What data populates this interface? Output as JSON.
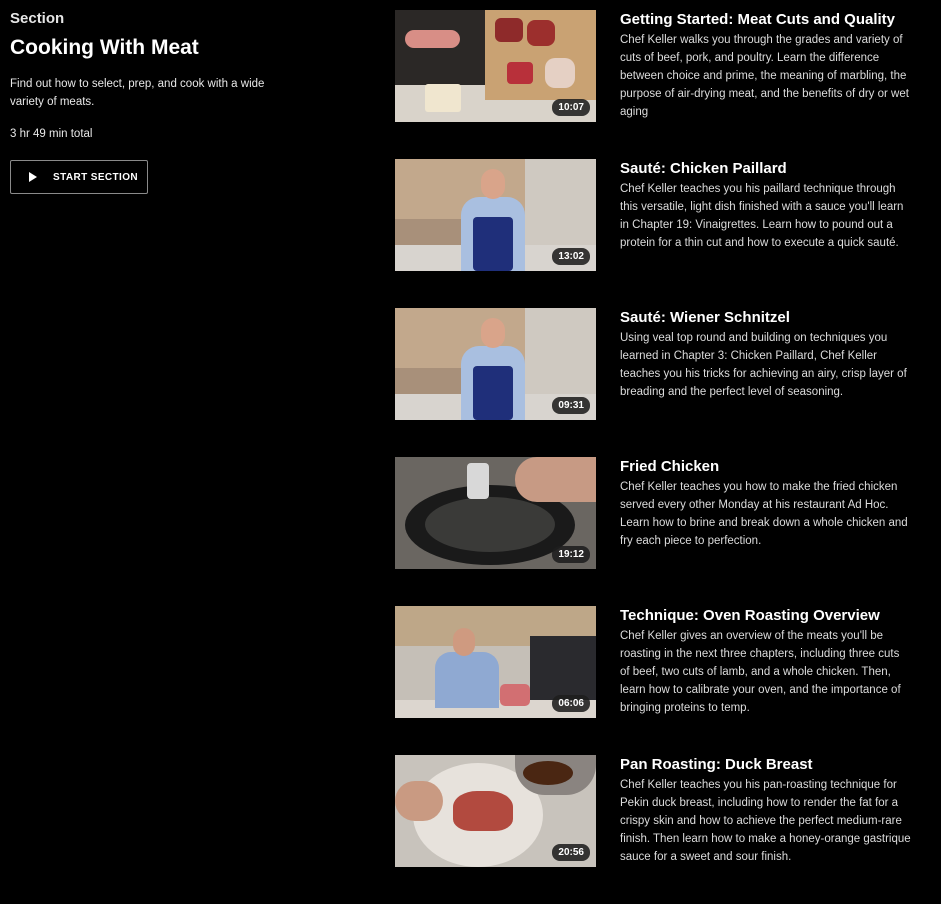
{
  "section": {
    "label": "Section",
    "title": "Cooking With Meat",
    "description": "Find out how to select, prep, and cook with a wide variety of meats.",
    "total": "3 hr 49 min total",
    "start_button": "START SECTION"
  },
  "lessons": [
    {
      "title": "Getting Started: Meat Cuts and Quality",
      "description": "Chef Keller walks you through the grades and variety of cuts of beef, pork, and poultry. Learn the difference between choice and prime, the meaning of marbling, the purpose of air-drying meat, and the benefits of dry or wet aging",
      "duration": "10:07"
    },
    {
      "title": "Sauté: Chicken Paillard",
      "description": "Chef Keller teaches you his paillard technique through this versatile, light dish finished with a sauce you'll learn in Chapter 19: Vinaigrettes. Learn how to pound out a protein for a thin cut and how to execute a quick sauté.",
      "duration": "13:02"
    },
    {
      "title": "Sauté: Wiener Schnitzel",
      "description": "Using veal top round and building on techniques you learned in Chapter 3: Chicken Paillard, Chef Keller teaches you his tricks for achieving an airy, crisp layer of breading and the perfect level of seasoning.",
      "duration": "09:31"
    },
    {
      "title": "Fried Chicken",
      "description": "Chef Keller teaches you how to make the fried chicken served every other Monday at his restaurant Ad Hoc. Learn how to brine and break down a whole chicken and fry each piece to perfection.",
      "duration": "19:12"
    },
    {
      "title": "Technique: Oven Roasting Overview",
      "description": "Chef Keller gives an overview of the meats you'll be roasting in the next three chapters, including three cuts of beef, two cuts of lamb, and a whole chicken. Then, learn how to calibrate your oven, and the importance of bringing proteins to temp.",
      "duration": "06:06"
    },
    {
      "title": "Pan Roasting: Duck Breast",
      "description": "Chef Keller teaches you his pan-roasting technique for Pekin duck breast, including how to render the fat for a crispy skin and how to achieve the perfect medium-rare finish. Then learn how to make a honey-orange gastrique sauce for a sweet and sour finish.",
      "duration": "20:56"
    }
  ]
}
